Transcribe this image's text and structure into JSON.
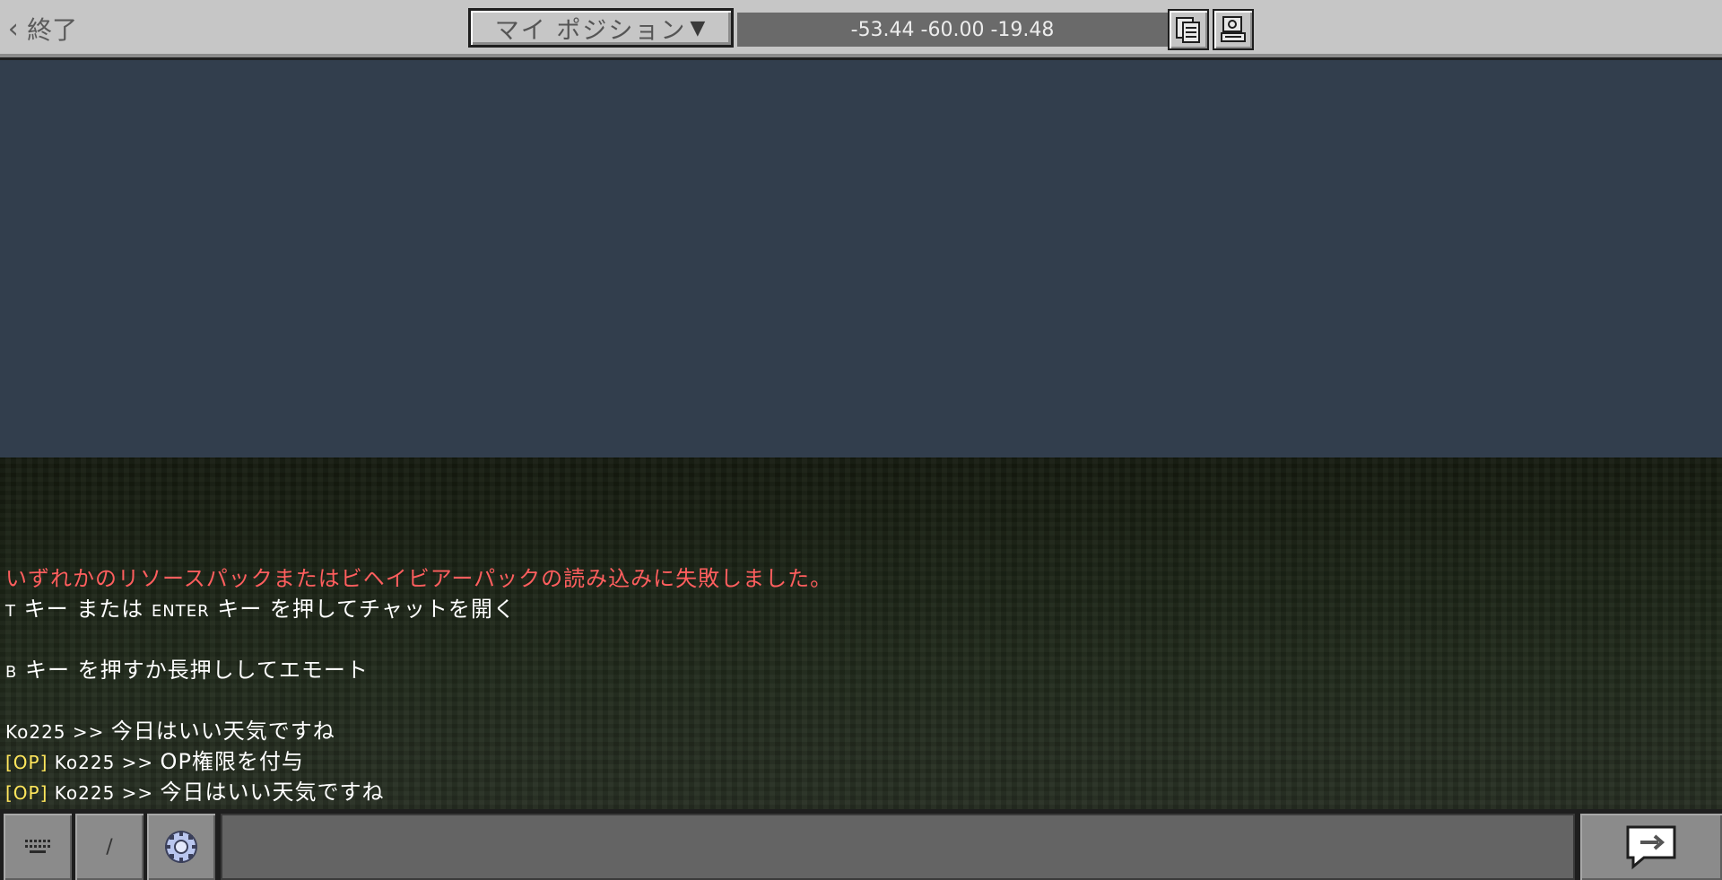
{
  "header": {
    "back_label": "終了",
    "position_dropdown": "マイ ポジション",
    "coordinates": "-53.44 -60.00 -19.48"
  },
  "chat": {
    "error_message": "いずれかのリソースパックまたはビヘイビアーパックの読み込みに失敗しました。",
    "hint_t_key": "T",
    "hint_t_mid": " キー または ",
    "hint_t_enter": "ENTER",
    "hint_t_tail": " キー を押してチャットを開く",
    "hint_b_key": "B",
    "hint_b_tail": " キー を押すか長押ししてエモート",
    "messages": [
      {
        "prefix": "",
        "sender": "Ko225 >> ",
        "text": "今日はいい天気ですね"
      },
      {
        "prefix": "[OP]",
        "sender": " Ko225 >> ",
        "text": "OP権限を付与"
      },
      {
        "prefix": "[OP]",
        "sender": " Ko225 >> ",
        "text": "今日はいい天気ですね"
      }
    ]
  },
  "bottombar": {
    "slash_label": "/",
    "input_value": ""
  },
  "icons": {
    "back": "chevron-left-icon",
    "dropdown": "triangle-down-icon",
    "copy_coords": "copy-icon",
    "copy_coords_alt": "copy-stamp-icon",
    "keyboard": "keyboard-icon",
    "emote": "emote-wheel-icon",
    "send": "send-speech-bubble-icon"
  },
  "colors": {
    "sky": "#323e4d",
    "error_text": "#ff5e5e",
    "op_tag": "#ffe65c",
    "panel": "#c6c6c6"
  }
}
